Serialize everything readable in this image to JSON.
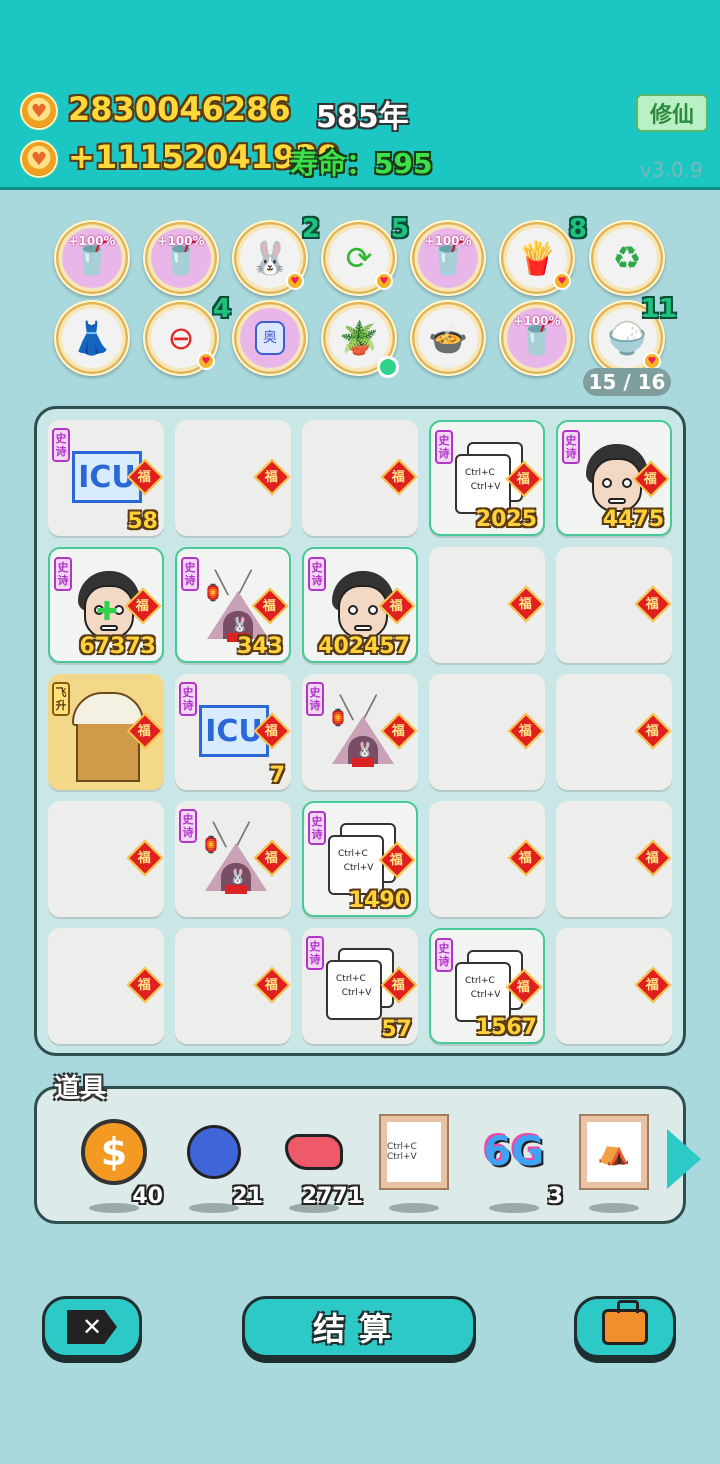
{
  "header": {
    "coins": "2830046286",
    "income": "+11152041929",
    "year": "585年",
    "life_label": "寿命：",
    "life_value": "595",
    "cultivate_button": "修仙",
    "version": "v3.0.9"
  },
  "buffs": {
    "row1": [
      {
        "icon": "milk-tea-cup-icon",
        "pct": "+100%"
      },
      {
        "icon": "milk-tea-cup-icon",
        "pct": "+100%"
      },
      {
        "icon": "rabbit-icon",
        "count": "2"
      },
      {
        "icon": "refresh-icon",
        "count": "5"
      },
      {
        "icon": "milk-tea-cup-icon",
        "pct": "+100%"
      },
      {
        "icon": "fries-icon",
        "count": "8"
      },
      {
        "icon": "recycle-icon"
      }
    ],
    "row2": [
      {
        "icon": "skirt-icon"
      },
      {
        "icon": "minus-icon",
        "count": "4"
      },
      {
        "icon": "jar-icon",
        "jar_label": "奥"
      },
      {
        "icon": "flower-pot-icon"
      },
      {
        "icon": "rice-cooker-icon"
      },
      {
        "icon": "milk-tea-cup-icon",
        "pct": "+100%"
      },
      {
        "icon": "rice-bowl-icon",
        "count": "11"
      }
    ],
    "slots": "15 / 16"
  },
  "board": {
    "fu_glyph": "福",
    "epic_tag": "史诗",
    "fly_tag": "飞升",
    "icu_text": "ICU",
    "ctrl_text": "Ctrl+C\n  Ctrl+V",
    "cells": [
      {
        "item": "icu",
        "num": "58"
      },
      {
        "item": "",
        "num": ""
      },
      {
        "item": "",
        "num": ""
      },
      {
        "item": "ctrl",
        "num": "2025"
      },
      {
        "item": "face",
        "num": "4475"
      },
      {
        "item": "face-cross",
        "num": "67373"
      },
      {
        "item": "tent",
        "num": "343"
      },
      {
        "item": "face",
        "num": "402457"
      },
      {
        "item": "",
        "num": ""
      },
      {
        "item": "",
        "num": ""
      },
      {
        "item": "cup",
        "num": ""
      },
      {
        "item": "icu",
        "num": "7"
      },
      {
        "item": "tent",
        "num": ""
      },
      {
        "item": "",
        "num": ""
      },
      {
        "item": "",
        "num": ""
      },
      {
        "item": "",
        "num": ""
      },
      {
        "item": "tent",
        "num": ""
      },
      {
        "item": "ctrl",
        "num": "1490"
      },
      {
        "item": "",
        "num": ""
      },
      {
        "item": "",
        "num": ""
      },
      {
        "item": "",
        "num": ""
      },
      {
        "item": "",
        "num": ""
      },
      {
        "item": "ctrl",
        "num": "57"
      },
      {
        "item": "ctrl",
        "num": "1567"
      },
      {
        "item": "",
        "num": ""
      }
    ]
  },
  "items": {
    "label": "道具",
    "list": [
      {
        "icon": "dollar-coin-icon",
        "glyph": "$",
        "qty": "40"
      },
      {
        "icon": "blueberry-icon",
        "qty": "21"
      },
      {
        "icon": "liver-icon",
        "qty": "2771"
      },
      {
        "icon": "framed-ctrl-card-icon",
        "text": "Ctrl+C Ctrl+V",
        "qty": ""
      },
      {
        "icon": "6g-icon",
        "text": "6G",
        "qty": "3"
      },
      {
        "icon": "framed-tent-icon",
        "qty": ""
      }
    ]
  },
  "actions": {
    "close_glyph": "✕",
    "settle": "结算"
  },
  "colors": {
    "top_bar": "#1cc6c3",
    "background": "#a9d9dc",
    "epic_border": "#45c996",
    "fu_red": "#e02020"
  }
}
